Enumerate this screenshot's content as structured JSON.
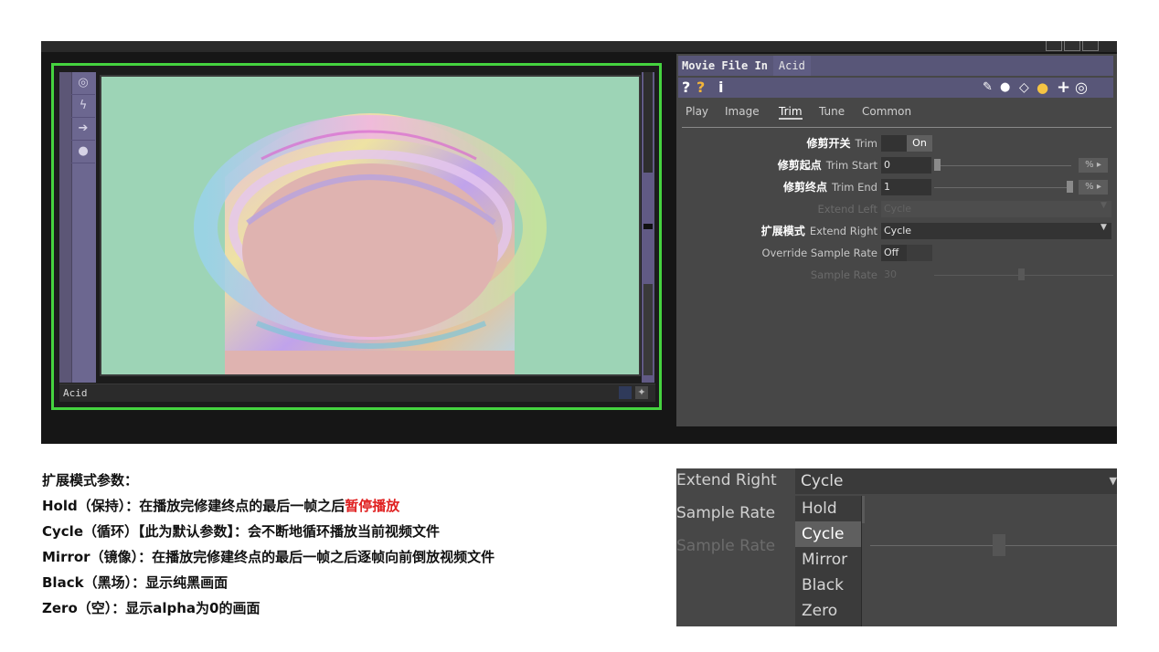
{
  "node": {
    "label": "Acid",
    "side_icons": [
      "target-icon",
      "lightning-icon",
      "arrow-right-icon",
      "lock-icon"
    ]
  },
  "panel": {
    "op_type": "Movie File In",
    "op_name": "Acid",
    "toolbar_left": [
      "?",
      "?",
      "i"
    ],
    "tabs": [
      "Play",
      "Image",
      "Trim",
      "Tune",
      "Common"
    ],
    "active_tab": "Trim",
    "params": {
      "trim": {
        "zh": "修剪开关",
        "en": "Trim",
        "value": "On"
      },
      "trim_start": {
        "zh": "修剪起点",
        "en": "Trim Start",
        "value": "0",
        "unit": "%"
      },
      "trim_end": {
        "zh": "修剪终点",
        "en": "Trim End",
        "value": "1",
        "unit": "%"
      },
      "extend_left": {
        "en": "Extend Left",
        "value": "Cycle"
      },
      "extend_right": {
        "zh": "扩展模式",
        "en": "Extend Right",
        "value": "Cycle"
      },
      "override_sample_rate": {
        "en": "Override Sample Rate",
        "value": "Off"
      },
      "sample_rate": {
        "en": "Sample Rate",
        "value": "30"
      }
    }
  },
  "description": {
    "heading": "扩展模式参数：",
    "hold_prefix": "Hold（保持）：在播放完修建终点的最后一帧之后",
    "hold_highlight": "暂停播放",
    "cycle": "Cycle（循环）【此为默认参数】：会不断地循环播放当前视频文件",
    "mirror": "Mirror（镜像）：在播放完修建终点的最后一帧之后逐帧向前倒放视频文件",
    "black": "Black（黑场）：显示纯黑画面",
    "zero": "Zero（空）：显示alpha为0的画面"
  },
  "zoom": {
    "extend_right_label": "Extend Right",
    "extend_right_value": "Cycle",
    "sample_rate_label": "Sample Rate",
    "sample_rate_label_dim": "Sample Rate",
    "options": [
      "Hold",
      "Cycle",
      "Mirror",
      "Black",
      "Zero"
    ],
    "selected_option": "Cycle"
  },
  "colors": {
    "node_outline": "#45d33f",
    "viewer_bg": "#9dd4b6",
    "highlight_red": "#e02020"
  }
}
